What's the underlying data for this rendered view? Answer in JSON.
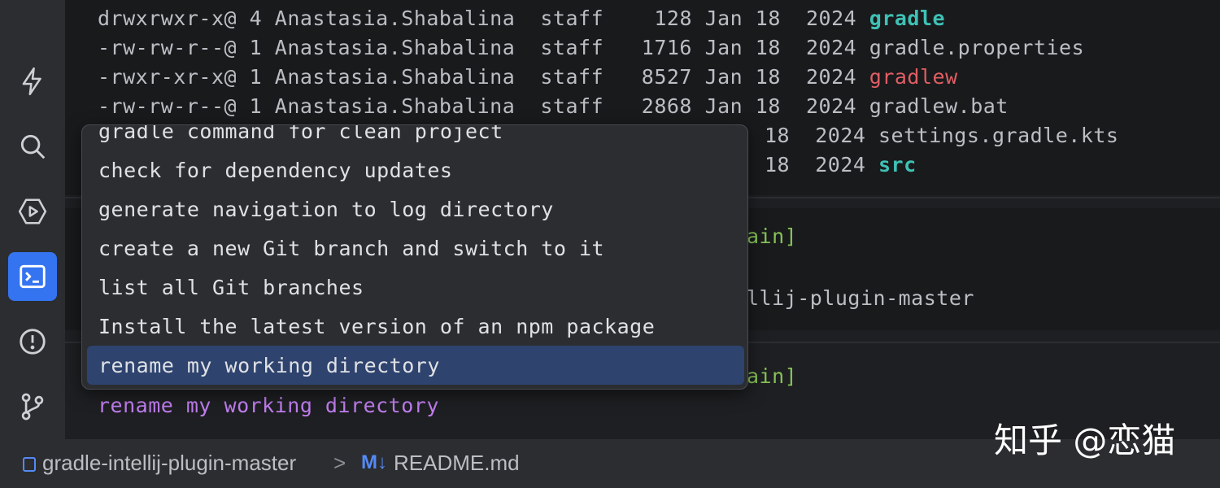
{
  "toolbar": {
    "tools": [
      {
        "name": "lightning-icon",
        "active": false
      },
      {
        "name": "search-icon",
        "active": false
      },
      {
        "name": "run-icon",
        "active": false
      },
      {
        "name": "terminal-icon",
        "active": true
      },
      {
        "name": "problems-icon",
        "active": false
      },
      {
        "name": "git-branch-icon",
        "active": false
      }
    ]
  },
  "listing": [
    {
      "perms": "drwxrwxr-x@",
      "links": "4",
      "owner": "Anastasia.Shabalina",
      "group": "staff",
      "size": "128",
      "month": "Jan",
      "day": "18",
      "year": "2024",
      "name": "gradle"
    },
    {
      "perms": "-rw-rw-r--@",
      "links": "1",
      "owner": "Anastasia.Shabalina",
      "group": "staff",
      "size": "1716",
      "month": "Jan",
      "day": "18",
      "year": "2024",
      "name": "gradle.properties"
    },
    {
      "perms": "-rwxr-xr-x@",
      "links": "1",
      "owner": "Anastasia.Shabalina",
      "group": "staff",
      "size": "8527",
      "month": "Jan",
      "day": "18",
      "year": "2024",
      "name": "gradlew"
    },
    {
      "perms": "-rw-rw-r--@",
      "links": "1",
      "owner": "Anastasia.Shabalina",
      "group": "staff",
      "size": "2868",
      "month": "Jan",
      "day": "18",
      "year": "2024",
      "name": "gradlew.bat"
    },
    {
      "day": "18",
      "year": "2024",
      "name": "settings.gradle.kts"
    },
    {
      "day": "18",
      "year": "2024",
      "name": "src"
    }
  ],
  "prompts": {
    "prompt1_branch": "ain]",
    "prompt1_path": "llij-plugin-master",
    "prompt2_branch": "ain]",
    "current_input": "rename my working directory"
  },
  "completion": {
    "items": [
      "gradle command for clean project",
      "check for dependency updates",
      "generate navigation to log directory",
      "create a new Git branch and switch to it",
      "list all Git branches",
      "Install the latest version of an npm package",
      "rename my working directory"
    ],
    "selected_index": 6
  },
  "statusbar": {
    "project": "gradle-intellij-plugin-master",
    "separator": ">",
    "file_icon": "M↓",
    "file": "README.md"
  },
  "watermark": "知乎 @恋猫",
  "colors": {
    "accent": "#3574f0",
    "directory": "#3fc1b5",
    "executable": "#e05e64",
    "branch": "#86c155",
    "command": "#c17ef0",
    "selection": "#2e436e"
  }
}
